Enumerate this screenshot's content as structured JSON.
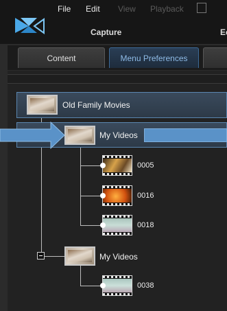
{
  "menubar": {
    "items": [
      {
        "label": "File",
        "enabled": true
      },
      {
        "label": "Edit",
        "enabled": true
      },
      {
        "label": "View",
        "enabled": false
      },
      {
        "label": "Playback",
        "enabled": false
      }
    ],
    "capture_label": "Capture",
    "edit_label": "Ec"
  },
  "tabs": [
    {
      "label": "Content",
      "active": false
    },
    {
      "label": "Menu Preferences",
      "active": true
    },
    {
      "label": "",
      "active": false
    }
  ],
  "tree": {
    "root": {
      "label": "Old Family Movies"
    },
    "menus": [
      {
        "label": "My Videos",
        "selected": true,
        "clips": [
          {
            "label": "0005"
          },
          {
            "label": "0016"
          },
          {
            "label": "0018"
          }
        ]
      },
      {
        "label": "My Videos",
        "selected": false,
        "collapse_toggle": "minus-icon",
        "clips": [
          {
            "label": "0038"
          }
        ]
      }
    ]
  },
  "colors": {
    "accent": "#5a92c8",
    "tab_active_text": "#8fbce8"
  },
  "icons": {
    "logo": "powerdirector-logo-icon",
    "arrow": "right-arrow-icon"
  }
}
